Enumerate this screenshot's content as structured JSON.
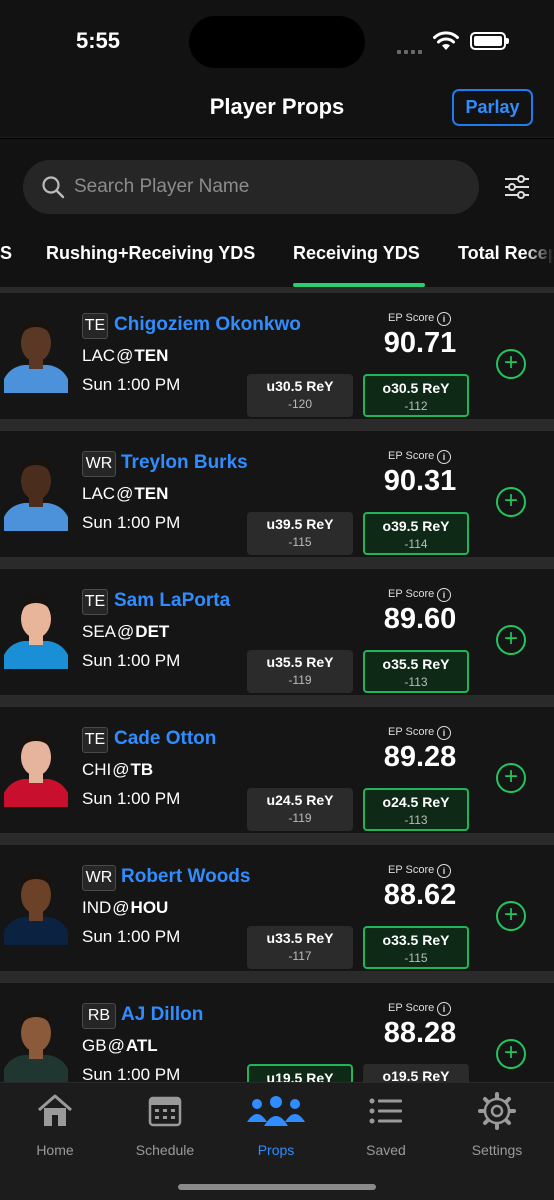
{
  "status": {
    "time": "5:55"
  },
  "header": {
    "title": "Player Props",
    "parlay_label": "Parlay"
  },
  "search": {
    "placeholder": "Search Player Name"
  },
  "tabs": [
    {
      "label": "S"
    },
    {
      "label": "Rushing+Receiving YDS"
    },
    {
      "label": "Receiving YDS",
      "active": true
    },
    {
      "label": "Total Recep"
    }
  ],
  "ep_label": "EP Score",
  "players": [
    {
      "pos": "TE",
      "name": "Chigoziem Okonkwo",
      "away": "LAC",
      "home": "TEN",
      "time": "Sun 1:00 PM",
      "score": "90.71",
      "under": "u30.5 ReY",
      "under_odds": "-120",
      "over": "o30.5 ReY",
      "over_odds": "-112",
      "selected": "over",
      "jersey": "#4b92db",
      "skin": "#5a3825"
    },
    {
      "pos": "WR",
      "name": "Treylon Burks",
      "away": "LAC",
      "home": "TEN",
      "time": "Sun 1:00 PM",
      "score": "90.31",
      "under": "u39.5 ReY",
      "under_odds": "-115",
      "over": "o39.5 ReY",
      "over_odds": "-114",
      "selected": "over",
      "jersey": "#4b92db",
      "skin": "#4a2d1d"
    },
    {
      "pos": "TE",
      "name": "Sam LaPorta",
      "away": "SEA",
      "home": "DET",
      "time": "Sun 1:00 PM",
      "score": "89.60",
      "under": "u35.5 ReY",
      "under_odds": "-119",
      "over": "o35.5 ReY",
      "over_odds": "-113",
      "selected": "over",
      "jersey": "#1a8fd6",
      "skin": "#e8b49a"
    },
    {
      "pos": "TE",
      "name": "Cade Otton",
      "away": "CHI",
      "home": "TB",
      "time": "Sun 1:00 PM",
      "score": "89.28",
      "under": "u24.5 ReY",
      "under_odds": "-119",
      "over": "o24.5 ReY",
      "over_odds": "-113",
      "selected": "over",
      "jersey": "#c8102e",
      "skin": "#e6b49c"
    },
    {
      "pos": "WR",
      "name": "Robert Woods",
      "away": "IND",
      "home": "HOU",
      "time": "Sun 1:00 PM",
      "score": "88.62",
      "under": "u33.5 ReY",
      "under_odds": "-117",
      "over": "o33.5 ReY",
      "over_odds": "-115",
      "selected": "over",
      "jersey": "#0b2241",
      "skin": "#6b4128"
    },
    {
      "pos": "RB",
      "name": "AJ Dillon",
      "away": "GB",
      "home": "ATL",
      "time": "Sun 1:00 PM",
      "score": "88.28",
      "under": "u19.5 ReY",
      "under_odds": "",
      "over": "o19.5 ReY",
      "over_odds": "",
      "selected": "under",
      "jersey": "#203731",
      "skin": "#8a5a3a"
    }
  ],
  "nav": [
    {
      "label": "Home",
      "icon": "home-icon"
    },
    {
      "label": "Schedule",
      "icon": "calendar-icon"
    },
    {
      "label": "Props",
      "icon": "people-icon",
      "active": true
    },
    {
      "label": "Saved",
      "icon": "list-icon"
    },
    {
      "label": "Settings",
      "icon": "gear-icon"
    }
  ],
  "colors": {
    "accent_blue": "#2f8dff",
    "accent_green": "#22c55e",
    "background": "#151515"
  }
}
